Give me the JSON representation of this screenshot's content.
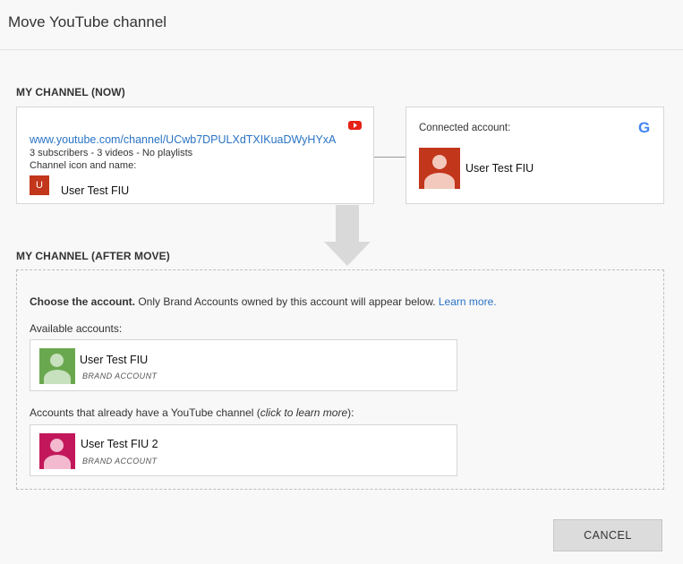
{
  "dialog": {
    "title": "Move YouTube channel"
  },
  "current": {
    "section_title": "MY CHANNEL (NOW)",
    "channel_url": "www.youtube.com/channel/UCwb7DPULXdTXIKuaDWyHYxA",
    "stats": "3 subscribers - 3 videos - No playlists",
    "icon_label": "Channel icon and name:",
    "avatar_letter": "U",
    "channel_name": "User Test FIU",
    "youtube_icon": "youtube-logo-icon"
  },
  "connected": {
    "label": "Connected account:",
    "google_icon": "G",
    "account_name": "User Test FIU"
  },
  "after": {
    "section_title": "MY CHANNEL (AFTER MOVE)",
    "choose_bold": "Choose the account.",
    "choose_text": " Only Brand Accounts owned by this account will appear below. ",
    "learn_more": "Learn more.",
    "available_label": "Available accounts:",
    "available_accounts": [
      {
        "name": "User Test FIU",
        "type": "BRAND ACCOUNT",
        "avatar_color": "#6aa84f"
      }
    ],
    "existing_label_pre": "Accounts that already have a YouTube channel (",
    "existing_label_italic": "click to learn more",
    "existing_label_post": "):",
    "existing_accounts": [
      {
        "name": "User Test FIU 2",
        "type": "BRAND ACCOUNT",
        "avatar_color": "#c2185b"
      }
    ]
  },
  "footer": {
    "cancel_label": "CANCEL"
  },
  "colors": {
    "link": "#2a73c4",
    "youtube_red": "#e62117",
    "avatar_red": "#c2361b"
  }
}
